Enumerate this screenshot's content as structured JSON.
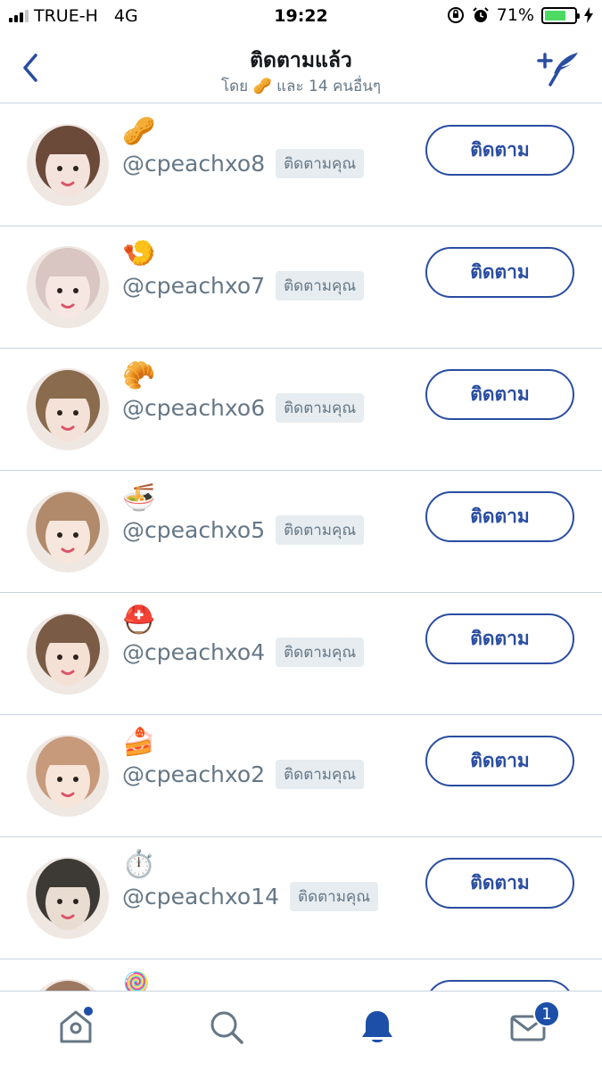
{
  "status_bar": {
    "carrier": "TRUE-H",
    "network": "4G",
    "time": "19:22",
    "battery_percent": "71%",
    "battery_level": 0.71
  },
  "header": {
    "title": "ติดตามแล้ว",
    "subtitle": "โดย 🥜 และ 14 คนอื่นๆ",
    "back_icon": "chevron-left-icon",
    "compose_icon": "add-feather-icon"
  },
  "follow_label": "ติดตาม",
  "follows_you_label": "ติดตามคุณ",
  "users": [
    {
      "emoji": "🥜",
      "handle": "@cpeachxo8"
    },
    {
      "emoji": "🍤",
      "handle": "@cpeachxo7"
    },
    {
      "emoji": "🥐",
      "handle": "@cpeachxo6"
    },
    {
      "emoji": "🍜",
      "handle": "@cpeachxo5"
    },
    {
      "emoji": "⛑️",
      "handle": "@cpeachxo4"
    },
    {
      "emoji": "🍰",
      "handle": "@cpeachxo2"
    },
    {
      "emoji": "⏱️",
      "handle": "@cpeachxo14"
    },
    {
      "emoji": "🍭",
      "handle": ""
    }
  ],
  "tabbar": {
    "home_icon": "home-icon",
    "search_icon": "search-icon",
    "notifications_icon": "bell-icon",
    "messages_icon": "mail-icon",
    "messages_badge": "1"
  },
  "colors": {
    "accent": "#2a4da1",
    "muted_text": "#657786",
    "divider": "#c8d3dc",
    "battery_fill": "#4cd964"
  }
}
